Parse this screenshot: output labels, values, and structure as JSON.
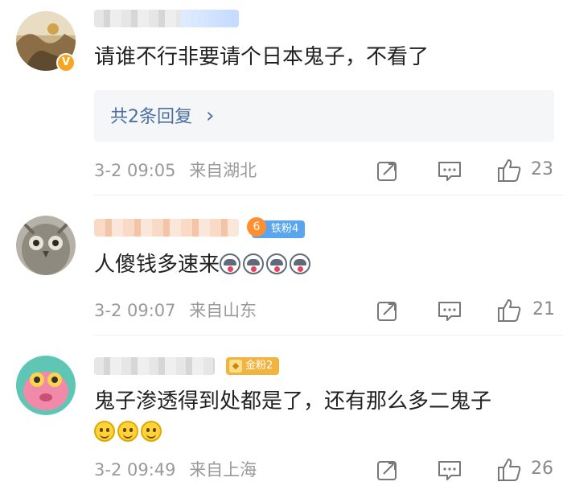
{
  "comments": [
    {
      "text": "请谁不行非要请个日本鬼子，不看了",
      "replies_label": "共2条回复",
      "replies_chevron": "›",
      "time": "3-2 09:05",
      "location": "来自湖北",
      "likes": "23",
      "verified_badge": "V",
      "avatar_icon": "landscape-avatar-icon"
    },
    {
      "text": "人傻钱多速来",
      "emoji_icon": "husky-emoji",
      "emoji_count": 4,
      "fan_badge": "铁粉4",
      "fan_badge_level": "6",
      "time": "3-2 09:07",
      "location": "来自山东",
      "likes": "21",
      "avatar_icon": "owl-avatar-icon"
    },
    {
      "text": "鬼子渗透得到处都是了，还有那么多二鬼子",
      "emoji_icon": "smile-emoji",
      "emoji_count": 3,
      "fan_badge": "金粉2",
      "time": "3-2 09:49",
      "location": "来自上海",
      "likes": "26",
      "avatar_icon": "pink-creature-avatar-icon"
    }
  ],
  "colors": {
    "link_blue": "#4b6fa3",
    "meta_gray": "#9a9a9a",
    "iron_fan": "#5aa6ee",
    "gold_fan": "#f2b440",
    "verified": "#f5a623"
  },
  "icons": {
    "repost": "repost-icon",
    "comment": "comment-icon",
    "like": "thumbs-up-icon"
  }
}
